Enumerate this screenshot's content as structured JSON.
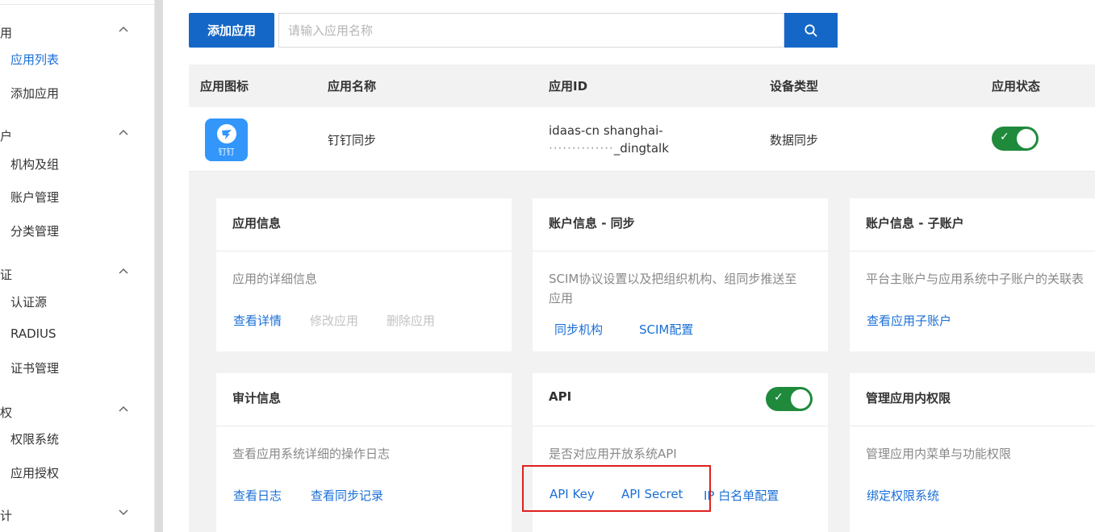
{
  "sidebar": {
    "groups": [
      {
        "label": "用",
        "items": [
          "应用列表",
          "添加应用"
        ]
      },
      {
        "label": "户",
        "items": [
          "机构及组",
          "账户管理",
          "分类管理"
        ]
      },
      {
        "label": "证",
        "items": [
          "认证源",
          "RADIUS",
          "证书管理"
        ]
      },
      {
        "label": "权",
        "items": [
          "权限系统",
          "应用授权"
        ]
      },
      {
        "label": "计",
        "items": []
      }
    ],
    "active_item": "应用列表"
  },
  "toolbar": {
    "add_label": "添加应用",
    "search_placeholder": "请输入应用名称",
    "search_icon": "search-icon"
  },
  "table": {
    "headers": [
      "应用图标",
      "应用名称",
      "应用ID",
      "设备类型",
      "应用状态"
    ],
    "row": {
      "icon_text": "钉钉",
      "name": "钉钉同步",
      "id_line1": "idaas-cn shanghai-",
      "id_line2_masked": "··············",
      "id_line2_suffix": "_dingtalk",
      "device_type": "数据同步",
      "status_on": true
    }
  },
  "cards": {
    "app_info": {
      "title": "应用信息",
      "desc": "应用的详细信息",
      "links": [
        "查看详情",
        "修改应用",
        "删除应用"
      ]
    },
    "account_sync": {
      "title": "账户信息 - 同步",
      "desc_line1": "SCIM协议设置以及把组织机构、组同步推送至",
      "desc_line2": "应用",
      "links": [
        "同步机构",
        "SCIM配置"
      ]
    },
    "sub_account": {
      "title": "账户信息 - 子账户",
      "desc": "平台主账户与应用系统中子账户的关联表",
      "links": [
        "查看应用子账户"
      ]
    },
    "audit": {
      "title": "审计信息",
      "desc": "查看应用系统详细的操作日志",
      "links": [
        "查看日志",
        "查看同步记录"
      ]
    },
    "api": {
      "title": "API",
      "desc": "是否对应用开放系统API",
      "links": [
        "API Key",
        "API Secret",
        "IP 白名单配置"
      ],
      "toggle_on": true
    },
    "permissions": {
      "title": "管理应用内权限",
      "desc": "管理应用内菜单与功能权限",
      "links": [
        "绑定权限系统"
      ]
    }
  },
  "colors": {
    "primary": "#1567c7",
    "link": "#1a6fd6",
    "toggle_on": "#1f8a3c",
    "highlight_box": "#e02020"
  }
}
